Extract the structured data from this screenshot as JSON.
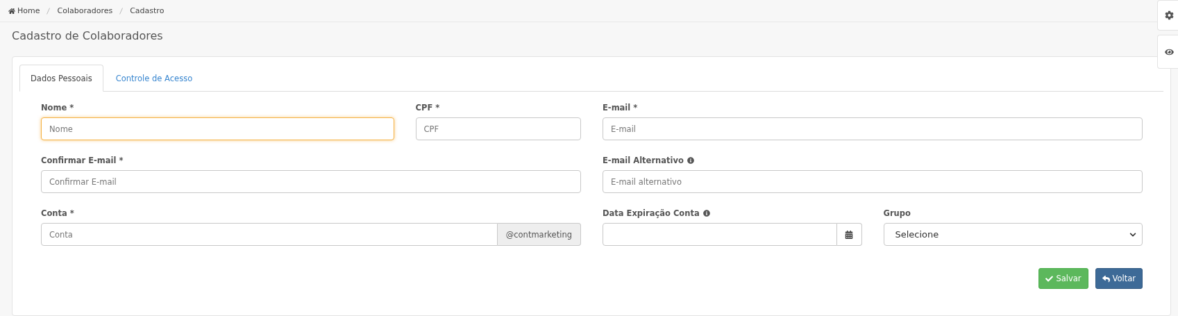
{
  "breadcrumb": [
    {
      "label": "Home",
      "kind": "home"
    },
    {
      "label": "Colaboradores",
      "kind": "link"
    },
    {
      "label": "Cadastro",
      "kind": "link"
    }
  ],
  "title": "Cadastro de Colaboradores",
  "tabs": [
    {
      "label": "Dados Pessoais",
      "selected": true
    },
    {
      "label": "Controle de Acesso",
      "selected": false
    }
  ],
  "fields": {
    "nome": {
      "label": "Nome *",
      "placeholder": "Nome",
      "kind": "text",
      "focused": true,
      "info": false
    },
    "cpf": {
      "label": "CPF *",
      "placeholder": "CPF",
      "kind": "text",
      "focused": false,
      "info": false
    },
    "email": {
      "label": "E-mail *",
      "placeholder": "E-mail",
      "kind": "text",
      "focused": false,
      "info": false
    },
    "confirmar": {
      "label": "Confirmar E-mail *",
      "placeholder": "Confirmar E-mail",
      "kind": "text",
      "focused": false,
      "info": false
    },
    "alternativo": {
      "label": "E-mail Alternativo",
      "placeholder": "E-mail alternativo",
      "kind": "text",
      "focused": false,
      "info": true
    },
    "conta": {
      "label": "Conta *",
      "placeholder": "Conta",
      "kind": "addon",
      "addon": "@contmarketing",
      "focused": false,
      "info": false
    },
    "expiracao": {
      "label": "Data Expiração Conta",
      "kind": "date",
      "focused": false,
      "info": true
    },
    "grupo": {
      "label": "Grupo",
      "value": "Selecione",
      "kind": "select",
      "focused": false,
      "info": false
    }
  },
  "buttons": [
    {
      "label": "Salvar",
      "kind": "save"
    },
    {
      "label": "Voltar",
      "kind": "back"
    }
  ]
}
